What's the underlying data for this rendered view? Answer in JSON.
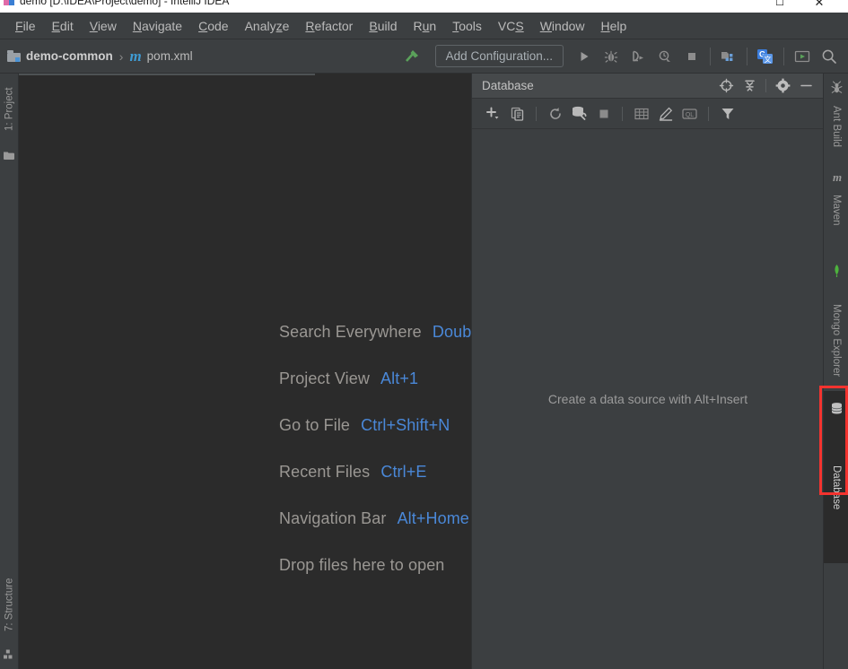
{
  "window": {
    "title": "demo [D:\\IDEA\\Project\\demo] - IntelliJ IDEA",
    "app_icon": "intellij-idea-logo",
    "maximize_label": "☐",
    "close_label": "✕"
  },
  "menubar": {
    "items": [
      {
        "label": "File",
        "mnemonic": "F"
      },
      {
        "label": "Edit",
        "mnemonic": "E"
      },
      {
        "label": "View",
        "mnemonic": "V"
      },
      {
        "label": "Navigate",
        "mnemonic": "N"
      },
      {
        "label": "Code",
        "mnemonic": "C"
      },
      {
        "label": "Analyze",
        "mnemonic": "z"
      },
      {
        "label": "Refactor",
        "mnemonic": "R"
      },
      {
        "label": "Build",
        "mnemonic": "B"
      },
      {
        "label": "Run",
        "mnemonic": "u"
      },
      {
        "label": "Tools",
        "mnemonic": "T"
      },
      {
        "label": "VCS",
        "mnemonic": "S"
      },
      {
        "label": "Window",
        "mnemonic": "W"
      },
      {
        "label": "Help",
        "mnemonic": "H"
      }
    ]
  },
  "navbar": {
    "breadcrumb": [
      {
        "label": "demo-common",
        "icon": "module-icon"
      },
      {
        "label": "pom.xml",
        "icon": "maven-file-icon"
      }
    ],
    "separator": "›",
    "build_icon": "hammer-icon",
    "run_configuration": "Add Configuration...",
    "buttons": [
      {
        "name": "run-button",
        "icon": "play-icon"
      },
      {
        "name": "debug-button",
        "icon": "bug-icon"
      },
      {
        "name": "run-with-coverage-button",
        "icon": "run-coverage-icon"
      },
      {
        "name": "profile-button",
        "icon": "profile-icon"
      },
      {
        "name": "stop-button",
        "icon": "stop-icon"
      },
      {
        "name": "project-structure-button",
        "icon": "project-structure-icon"
      },
      {
        "name": "translate-button",
        "icon": "google-translate-icon"
      },
      {
        "name": "presentation-button",
        "icon": "presentation-icon"
      },
      {
        "name": "search-everywhere-button",
        "icon": "search-icon"
      }
    ]
  },
  "left_strip": {
    "tabs": [
      {
        "label": "1: Project",
        "icon": "folder-icon"
      },
      {
        "label": "7: Structure",
        "icon": "structure-icon"
      }
    ]
  },
  "editor": {
    "hints": [
      {
        "action": "Search Everywhere",
        "shortcut": "Double Shift"
      },
      {
        "action": "Project View",
        "shortcut": "Alt+1"
      },
      {
        "action": "Go to File",
        "shortcut": "Ctrl+Shift+N"
      },
      {
        "action": "Recent Files",
        "shortcut": "Ctrl+E"
      },
      {
        "action": "Navigation Bar",
        "shortcut": "Alt+Home"
      },
      {
        "action": "Drop files here to open",
        "shortcut": ""
      }
    ]
  },
  "database_panel": {
    "title": "Database",
    "header_buttons": [
      {
        "name": "locate-data-source-button",
        "icon": "crosshair-icon"
      },
      {
        "name": "collapse-all-button",
        "icon": "collapse-all-icon"
      },
      {
        "name": "settings-button",
        "icon": "gear-icon"
      },
      {
        "name": "hide-button",
        "icon": "minimize-icon"
      }
    ],
    "toolbar_buttons": [
      {
        "name": "add-data-source-button",
        "icon": "plus-dropdown-icon"
      },
      {
        "name": "duplicate-button",
        "icon": "copy-icon"
      },
      {
        "name": "refresh-button",
        "icon": "refresh-icon"
      },
      {
        "name": "data-source-properties-button",
        "icon": "db-wrench-icon"
      },
      {
        "name": "stop-button",
        "icon": "stop-square-icon"
      },
      {
        "name": "open-table-editor-button",
        "icon": "table-grid-icon"
      },
      {
        "name": "modify-button",
        "icon": "pencil-icon"
      },
      {
        "name": "jump-to-query-console-button",
        "icon": "ql-console-icon"
      },
      {
        "name": "filter-button",
        "icon": "filter-icon"
      }
    ],
    "empty_message": "Create a data source with Alt+Insert"
  },
  "right_strip": {
    "tabs": [
      {
        "label": "Ant Build",
        "icon": "ant-icon",
        "active": false
      },
      {
        "label": "Maven",
        "icon": "maven-m-icon",
        "active": false
      },
      {
        "label": "Mongo Explorer",
        "icon": "mongo-leaf-icon",
        "active": false
      },
      {
        "label": "Database",
        "icon": "database-cylinder-icon",
        "active": true
      }
    ]
  },
  "annotation": {
    "name": "highlight-rectangle",
    "target": "Database",
    "color": "#f4332f"
  },
  "colors": {
    "editor_background": "#2b2b2b",
    "panel_background": "#3c3f41",
    "panel_header": "#46494b",
    "text": "#bbbbbb",
    "shortcut_blue": "#4a88d8",
    "accent_red": "#f4332f"
  }
}
